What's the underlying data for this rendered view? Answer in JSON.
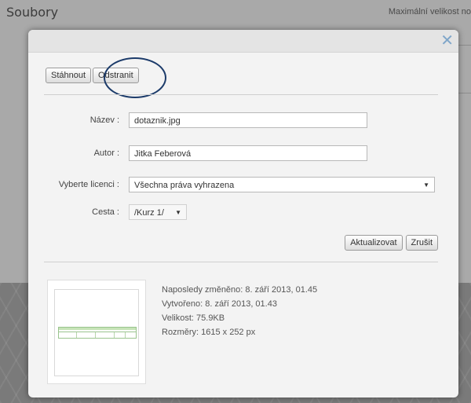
{
  "background": {
    "title": "Soubory",
    "max_size_text": "Maximální velikost no"
  },
  "dialog": {
    "close_icon": "close-x-icon",
    "toolbar": {
      "download_label": "Stáhnout",
      "delete_label": "Odstranit"
    },
    "form": {
      "name_label": "Název :",
      "name_value": "dotaznik.jpg",
      "author_label": "Autor :",
      "author_value": "Jitka Feberová",
      "license_label": "Vyberte licenci :",
      "license_value": "Všechna práva vyhrazena",
      "path_label": "Cesta :",
      "path_value": "/Kurz 1/"
    },
    "actions": {
      "update_label": "Aktualizovat",
      "cancel_label": "Zrušit"
    },
    "file_info": {
      "modified": "Naposledy změněno: 8. září 2013, 01.45",
      "created": "Vytvořeno: 8. září 2013, 01.43",
      "size": "Velikost: 75.9KB",
      "dimensions": "Rozměry: 1615 x 252 px"
    }
  },
  "colors": {
    "close_icon": "#7fa6c9",
    "highlight_ring": "#1c3b6a",
    "dialog_bg": "#f3f3f3"
  }
}
